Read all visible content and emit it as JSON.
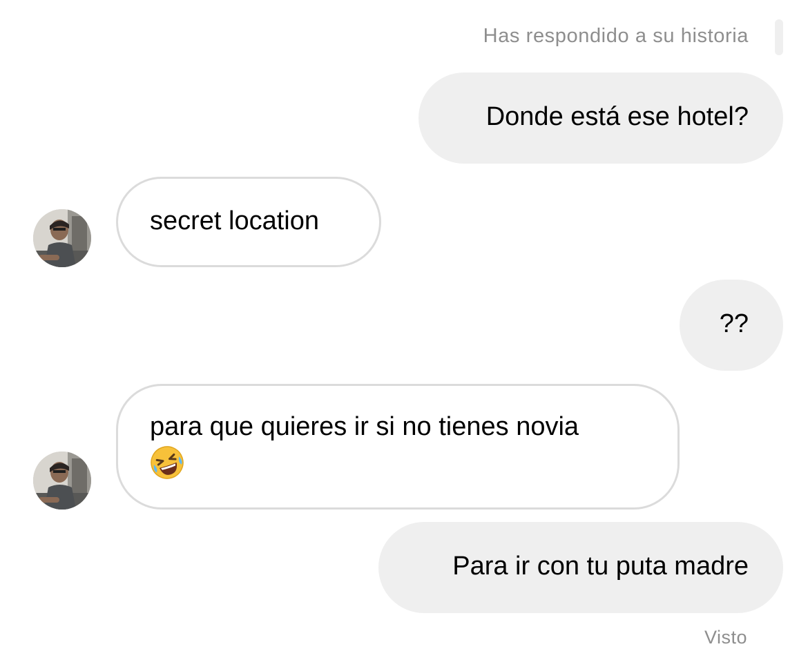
{
  "thread": {
    "story_reply_note": "Has respondido a su historia",
    "seen_label": "Visto"
  },
  "messages": [
    {
      "from": "me",
      "text": "Donde está ese hotel?"
    },
    {
      "from": "them",
      "text": "secret location"
    },
    {
      "from": "me",
      "text": "??"
    },
    {
      "from": "them",
      "text": "para que quieres ir si no tienes novia",
      "emoji": "🤣",
      "emoji_icon": "rolling-on-floor-laughing-icon"
    },
    {
      "from": "me",
      "text": "Para ir con tu puta madre"
    }
  ],
  "colors": {
    "outgoing_bubble": "#efefef",
    "incoming_border": "#dbdbdb",
    "meta_text": "#8e8e8e",
    "emoji_yellow": "#f7c13a"
  }
}
